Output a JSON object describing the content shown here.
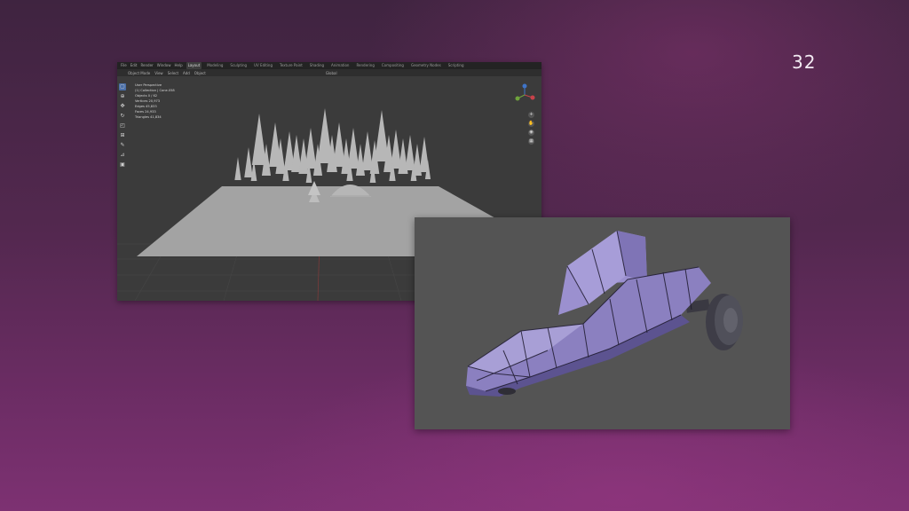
{
  "slide": {
    "page_number": "32"
  },
  "blender": {
    "menus": [
      "File",
      "Edit",
      "Render",
      "Window",
      "Help"
    ],
    "workspaces": [
      "Layout",
      "Modeling",
      "Sculpting",
      "UV Editing",
      "Texture Paint",
      "Shading",
      "Animation",
      "Rendering",
      "Compositing",
      "Geometry Nodes",
      "Scripting"
    ],
    "header_items": [
      "Object Mode",
      "View",
      "Select",
      "Add",
      "Object",
      "Global"
    ],
    "stats": [
      "User Perspective",
      "(1) Collection | Cone.058",
      "Objects    0 / 62",
      "Vertices   20,973",
      "Edges      45,833",
      "Faces      24,933",
      "Triangles  41,834"
    ],
    "icons": [
      "select-box-icon",
      "cursor-icon",
      "move-icon",
      "rotate-icon",
      "scale-icon",
      "transform-icon",
      "annotate-icon",
      "measure-icon",
      "add-cube-icon"
    ],
    "colors": {
      "viewport": "#3b3b3b",
      "ground": "#a3a3a3",
      "trees": "#b7b7b7",
      "gizmo_x": "#c8424a",
      "gizmo_y": "#6fa33c",
      "gizmo_z": "#3f74c8"
    }
  },
  "render": {
    "colors": {
      "background": "#545454",
      "body": "#8b80c0",
      "body_shadow": "#5c5390",
      "wireframe": "#1e1a2e",
      "tire": "#3e3d47"
    }
  }
}
